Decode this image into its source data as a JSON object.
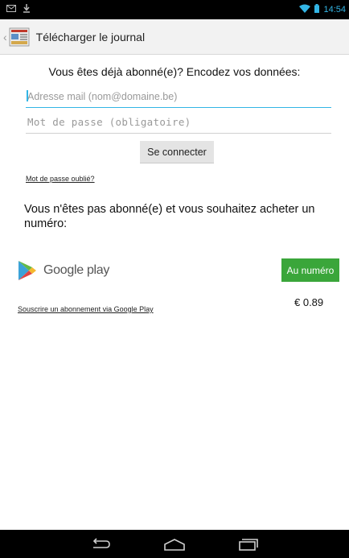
{
  "status_bar": {
    "time": "14:54",
    "icons": [
      "gmail-icon",
      "download-icon",
      "wifi-icon",
      "battery-icon"
    ],
    "accent_color": "#33b5e5"
  },
  "action_bar": {
    "title": "Télécharger le journal",
    "app_icon": "newspaper-icon"
  },
  "login": {
    "prompt": "Vous êtes déjà abonné(e)? Encodez vos données:",
    "email_placeholder": "Adresse mail (nom@domaine.be)",
    "password_placeholder": "Mot de passe (obligatoire)",
    "connect_label": "Se connecter",
    "forgot_label": "Mot de passe oublié?"
  },
  "purchase": {
    "not_subscribed_text": "Vous n'êtes pas abonné(e) et vous souhaitez acheter un numéro:",
    "google_play_label": "Google play",
    "buy_label": "Au numéro",
    "buy_color": "#3aa63a",
    "subscribe_label": "Souscrire un abonnement via Google Play",
    "price": "€ 0.89"
  },
  "nav_bar": {
    "icons": [
      "back-icon",
      "home-icon",
      "recents-icon"
    ]
  }
}
